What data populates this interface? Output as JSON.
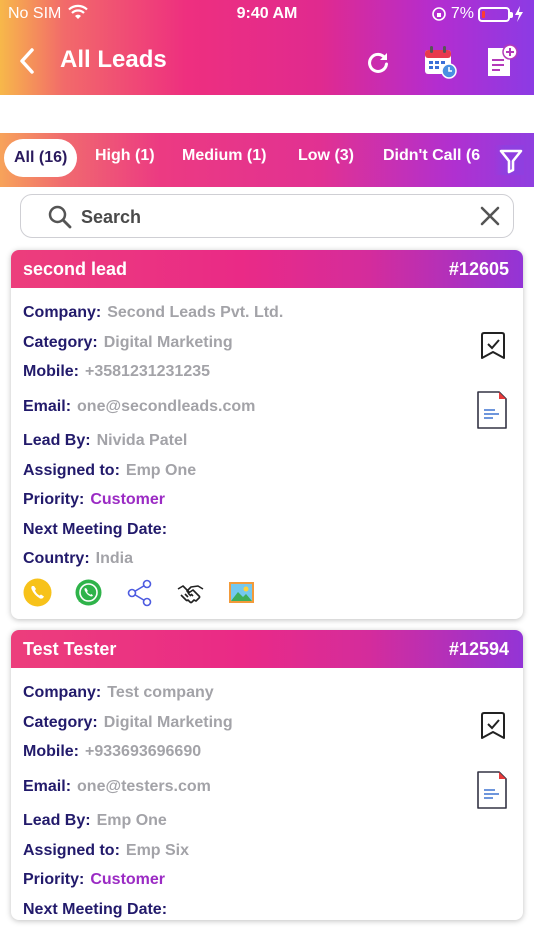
{
  "status": {
    "carrier": "No SIM",
    "time": "9:40 AM",
    "battery": "7%"
  },
  "header": {
    "title": "All Leads"
  },
  "tabs": [
    {
      "label": "All (16)",
      "active": true
    },
    {
      "label": "High (1)"
    },
    {
      "label": "Medium (1)"
    },
    {
      "label": "Low (3)"
    },
    {
      "label": "Didn't Call (6"
    }
  ],
  "search": {
    "placeholder": "Search"
  },
  "labels": {
    "company": "Company:",
    "category": "Category:",
    "mobile": "Mobile:",
    "email": "Email:",
    "lead_by": "Lead By:",
    "assigned_to": "Assigned to:",
    "priority": "Priority:",
    "next_meeting": "Next Meeting Date:",
    "country": "Country:"
  },
  "leads": [
    {
      "name": "second lead",
      "number": "#12605",
      "company": "Second Leads Pvt. Ltd.",
      "category": "Digital Marketing",
      "mobile": "+3581231231235",
      "email": "one@secondleads.com",
      "lead_by": "Nividа Patel",
      "assigned_to": "Emp One",
      "priority": "Customer",
      "next_meeting": "",
      "country": "India"
    },
    {
      "name": "Test Tester",
      "number": "#12594",
      "company": "Test company",
      "category": "Digital Marketing",
      "mobile": "+933693696690",
      "email": "one@testers.com",
      "lead_by": "Emp One",
      "assigned_to": "Emp Six",
      "priority": "Customer",
      "next_meeting": ""
    }
  ]
}
